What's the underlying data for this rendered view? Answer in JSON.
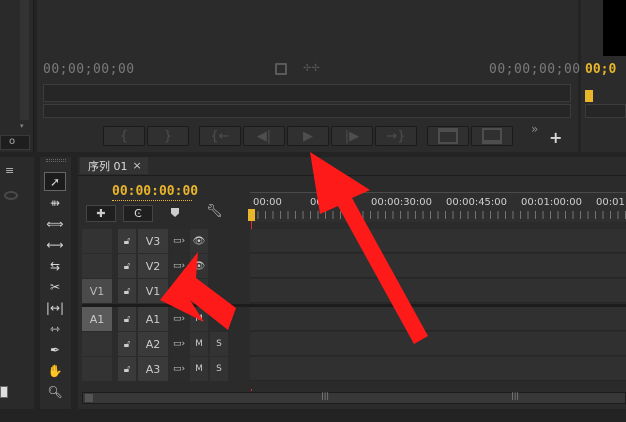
{
  "source_monitor": {
    "timecode_left": "00;00;00;00",
    "timecode_right": "00;00;00;00",
    "film_icon": "film-strip-icon",
    "drag_icon": "drag-handle-icon"
  },
  "transport": {
    "mark_in": "{",
    "mark_out": "}",
    "goto_in": "{←",
    "step_back": "◀|",
    "play": "▶",
    "step_forward": "|▶",
    "goto_out": "→}",
    "insert": "insert",
    "overwrite": "overwrite",
    "more": "»",
    "add": "+"
  },
  "program_monitor": {
    "timecode": "00;0"
  },
  "timeline": {
    "tab_label": "序列 01",
    "tab_close": "×",
    "playhead_timecode": "00:00:00:00",
    "ruler_labels": [
      "00:00",
      "00:00:15:00",
      "00:00:30:00",
      "00:00:45:00",
      "00:01:00:00",
      "00:01:8"
    ],
    "ruler_visible": [
      "00:00",
      "00:00",
      "00:00:30:00",
      "00:00:45:00",
      "00:01:00:00",
      "00:01:8"
    ],
    "tracks": [
      {
        "name": "V3",
        "source": "",
        "type": "video"
      },
      {
        "name": "V2",
        "source": "",
        "type": "video"
      },
      {
        "name": "V1",
        "source": "V1",
        "type": "video"
      },
      {
        "name": "A1",
        "source": "A1",
        "type": "audio"
      },
      {
        "name": "A2",
        "source": "",
        "type": "audio"
      },
      {
        "name": "A3",
        "source": "",
        "type": "audio"
      }
    ],
    "mute_label": "M",
    "solo_label": "S",
    "scroll_grip": "|||"
  },
  "tools": [
    "selection-tool-icon",
    "track-select-tool-icon",
    "ripple-edit-tool-icon",
    "rolling-edit-tool-icon",
    "rate-stretch-tool-icon",
    "razor-tool-icon",
    "slip-tool-icon",
    "slide-tool-icon",
    "pen-tool-icon",
    "hand-tool-icon",
    "zoom-tool-icon"
  ],
  "left_panel": {
    "tab_menu": "≡",
    "eye_icon": "eye-icon"
  },
  "colors": {
    "timecode_yellow": "#e9b52b",
    "playhead_red": "#d63030",
    "arrow_red": "#ff1a1a"
  }
}
